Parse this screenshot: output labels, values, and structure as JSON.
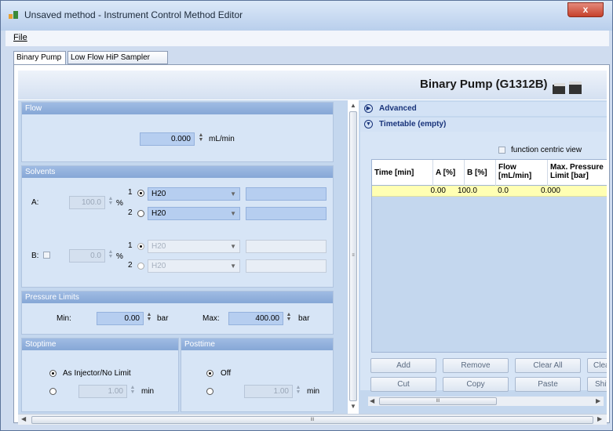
{
  "window": {
    "title": "Unsaved method - Instrument Control Method Editor",
    "close": "x"
  },
  "menu": {
    "file": "File"
  },
  "tabs": [
    "Binary Pump",
    "Low Flow HiP Sampler"
  ],
  "header": {
    "title": "Binary Pump (G1312B)"
  },
  "flow": {
    "section": "Flow",
    "value": "0.000",
    "unit": "mL/min"
  },
  "solvents": {
    "section": "Solvents",
    "a_label": "A:",
    "a_value": "100.0",
    "pct": "%",
    "a1_num": "1",
    "a1_solvent": "H20",
    "a2_num": "2",
    "a2_solvent": "H20",
    "b_label": "B:",
    "b_value": "0.0",
    "b1_num": "1",
    "b1_solvent": "H20",
    "b2_num": "2",
    "b2_solvent": "H20"
  },
  "pressure": {
    "section": "Pressure Limits",
    "min_label": "Min:",
    "min_value": "0.00",
    "max_label": "Max:",
    "max_value": "400.00",
    "unit": "bar"
  },
  "stoptime": {
    "section": "Stoptime",
    "option1": "As Injector/No Limit",
    "value": "1.00",
    "unit": "min"
  },
  "posttime": {
    "section": "Posttime",
    "option1": "Off",
    "value": "1.00",
    "unit": "min"
  },
  "advanced": {
    "label": "Advanced"
  },
  "timetable": {
    "label": "Timetable (empty)",
    "fcv": "function centric view",
    "headers": [
      "Time [min]",
      "A [%]",
      "B [%]",
      "Flow [mL/min]",
      "Max. Pressure Limit [bar]"
    ],
    "row": [
      "0.00",
      "100.0",
      "0.0",
      "0.000",
      ""
    ]
  },
  "buttons": {
    "add": "Add",
    "remove": "Remove",
    "clear_all": "Clear All",
    "clear": "Clear",
    "cut": "Cut",
    "copy": "Copy",
    "paste": "Paste",
    "shift": "Shift"
  },
  "scroll_glyph": "III",
  "colors": {
    "section_head": "#8fb0dd",
    "field": "#b6cef0",
    "highlight_row": "#ffffb3"
  }
}
